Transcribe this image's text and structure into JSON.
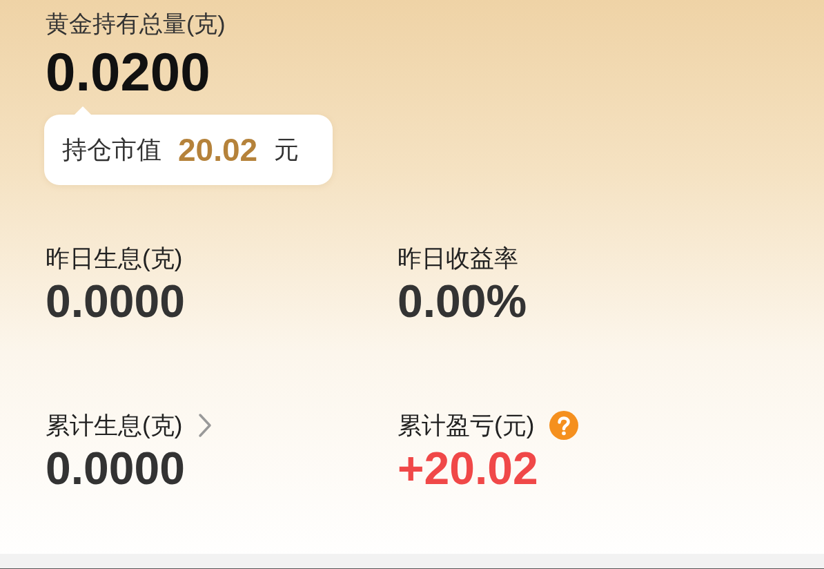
{
  "holding": {
    "label": "黄金持有总量(克)",
    "value": "0.0200"
  },
  "tooltip": {
    "label": "持仓市值",
    "value": "20.02",
    "unit": "元"
  },
  "stats": [
    {
      "label": "昨日生息(克)",
      "value": "0.0000",
      "kind": "plain",
      "color": "#333333"
    },
    {
      "label": "昨日收益率",
      "value": "0.00%",
      "kind": "plain",
      "color": "#333333"
    },
    {
      "label": "累计生息(克)",
      "value": "0.0000",
      "kind": "link",
      "color": "#333333"
    },
    {
      "label": "累计盈亏(元)",
      "value": "+20.02",
      "kind": "help",
      "color": "#f04848"
    }
  ]
}
